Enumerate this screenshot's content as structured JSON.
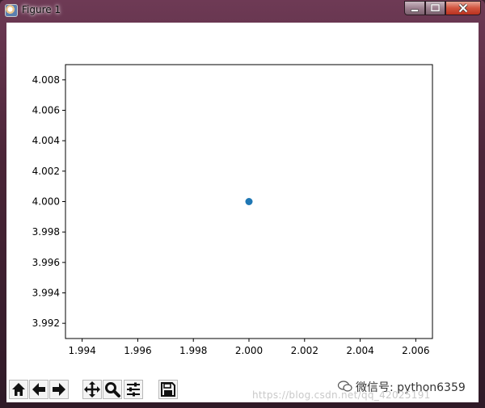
{
  "window": {
    "title": "Figure 1"
  },
  "chart_data": {
    "type": "scatter",
    "x": [
      2.0
    ],
    "y": [
      4.0
    ],
    "xlim": [
      1.9934,
      2.0066
    ],
    "ylim": [
      3.991,
      4.009
    ],
    "xticks": [
      "1.994",
      "1.996",
      "1.998",
      "2.000",
      "2.002",
      "2.004",
      "2.006"
    ],
    "yticks": [
      "3.992",
      "3.994",
      "3.996",
      "3.998",
      "4.000",
      "4.002",
      "4.004",
      "4.006",
      "4.008"
    ],
    "marker_color": "#1f77b4",
    "grid": false,
    "title": "",
    "xlabel": "",
    "ylabel": ""
  },
  "toolbar": {
    "buttons": [
      "home-icon",
      "back-arrow-icon",
      "forward-arrow-icon",
      "pan-icon",
      "zoom-icon",
      "subplots-config-icon",
      "save-icon"
    ]
  },
  "watermark": {
    "text": "微信号: python6359",
    "url": "https://blog.csdn.net/qq_42025191"
  }
}
